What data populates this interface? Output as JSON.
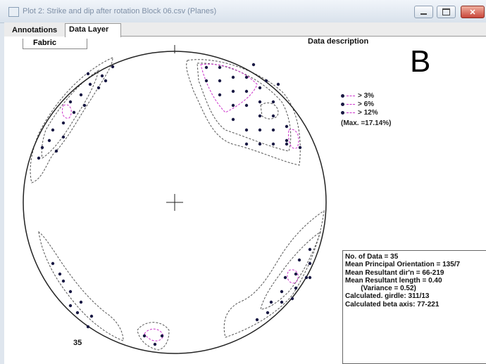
{
  "window": {
    "title": "Plot 2: Strike and dip after rotation Block 06.csv  (Planes)"
  },
  "tabs": [
    {
      "label": "Annotations"
    },
    {
      "label": "Data Layer"
    }
  ],
  "fabric_label": "Fabric",
  "data_description_label": "Data description",
  "panel_letter": "B",
  "legend": {
    "items": [
      {
        "label": "> 3%"
      },
      {
        "label": "> 6%"
      },
      {
        "label": "> 12%"
      }
    ],
    "max_label": "(Max. =17.14%)"
  },
  "stats": {
    "lines": [
      "No. of Data = 35",
      "Mean Principal Orientation = 135/7",
      "Mean Resultant dir'n = 66-219",
      "Mean Resultant length = 0.40",
      "        (Variance = 0.52)",
      "Calculated. girdle: 311/13",
      "Calculated beta axis: 77-221"
    ]
  },
  "count_label": "35",
  "colors": {
    "titlebar": "#dbe4ee",
    "point": "#1a1a44",
    "contour_dark": "#555555",
    "contour_pink": "#cc33cc"
  }
}
